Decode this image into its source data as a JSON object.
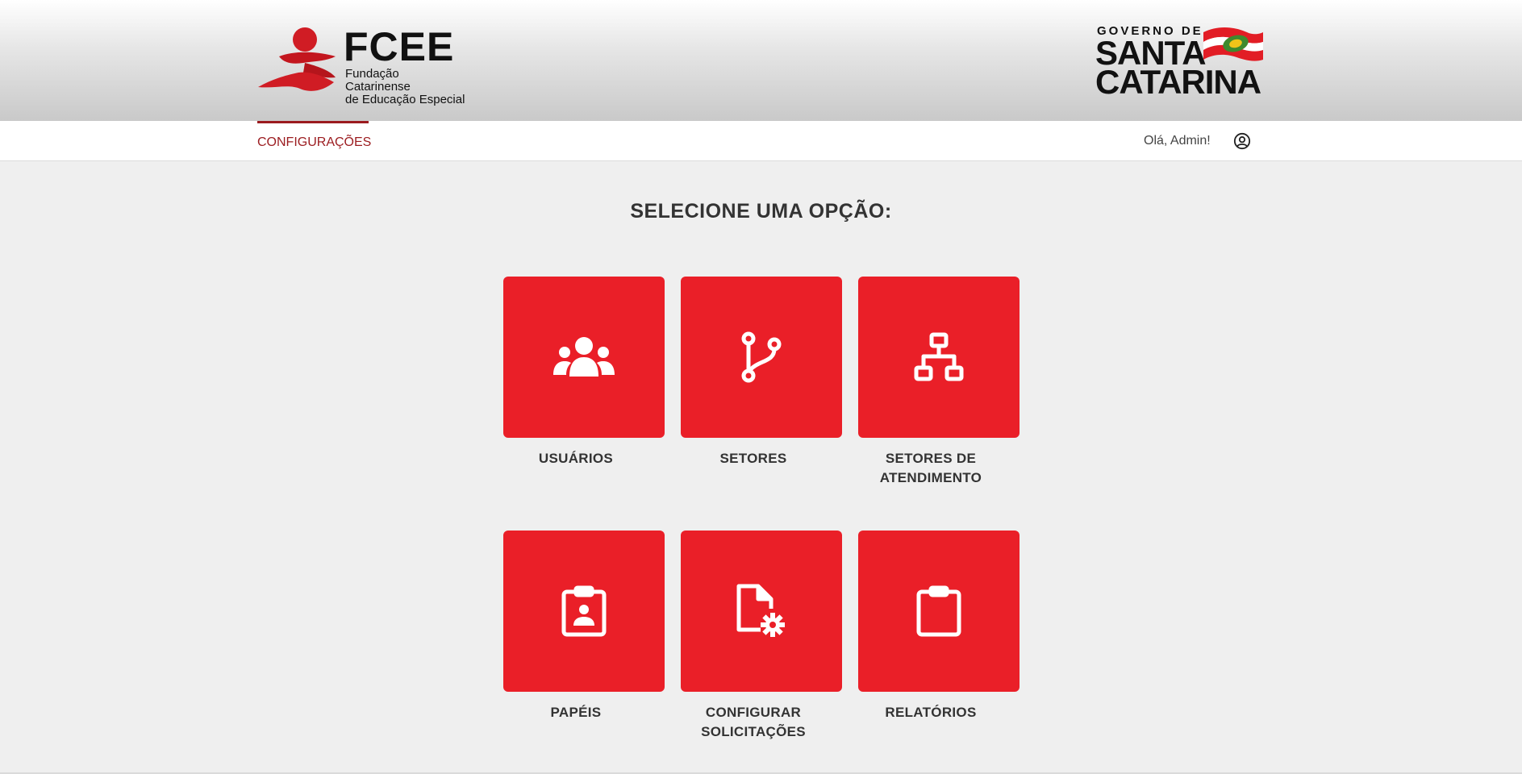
{
  "header": {
    "fcee_logo": {
      "title": "FCEE",
      "subtitle_line1": "Fundação Catarinense",
      "subtitle_line2": "de Educação Especial"
    },
    "gov_logo": {
      "line_small": "GOVERNO DE",
      "line1": "SANTA",
      "line2": "CATARINA"
    }
  },
  "nav": {
    "active_tab": "CONFIGURAÇÕES",
    "greeting": "Olá, Admin!",
    "user_icon": "user-circle-icon"
  },
  "main": {
    "title": "SELECIONE UMA OPÇÃO:",
    "options": [
      {
        "label_line1": "USUÁRIOS",
        "label_line2": "",
        "icon": "users-icon"
      },
      {
        "label_line1": "SETORES",
        "label_line2": "",
        "icon": "branch-icon"
      },
      {
        "label_line1": "SETORES DE",
        "label_line2": "ATENDIMENTO",
        "icon": "sitemap-icon"
      },
      {
        "label_line1": "PAPÉIS",
        "label_line2": "",
        "icon": "clipboard-user-icon"
      },
      {
        "label_line1": "CONFIGURAR",
        "label_line2": "SOLICITAÇÕES",
        "icon": "file-gear-icon"
      },
      {
        "label_line1": "RELATÓRIOS",
        "label_line2": "",
        "icon": "clipboard-icon"
      }
    ]
  },
  "colors": {
    "accent": "#ea1f28",
    "nav_active": "#9b1b1f",
    "background": "#efefef"
  }
}
